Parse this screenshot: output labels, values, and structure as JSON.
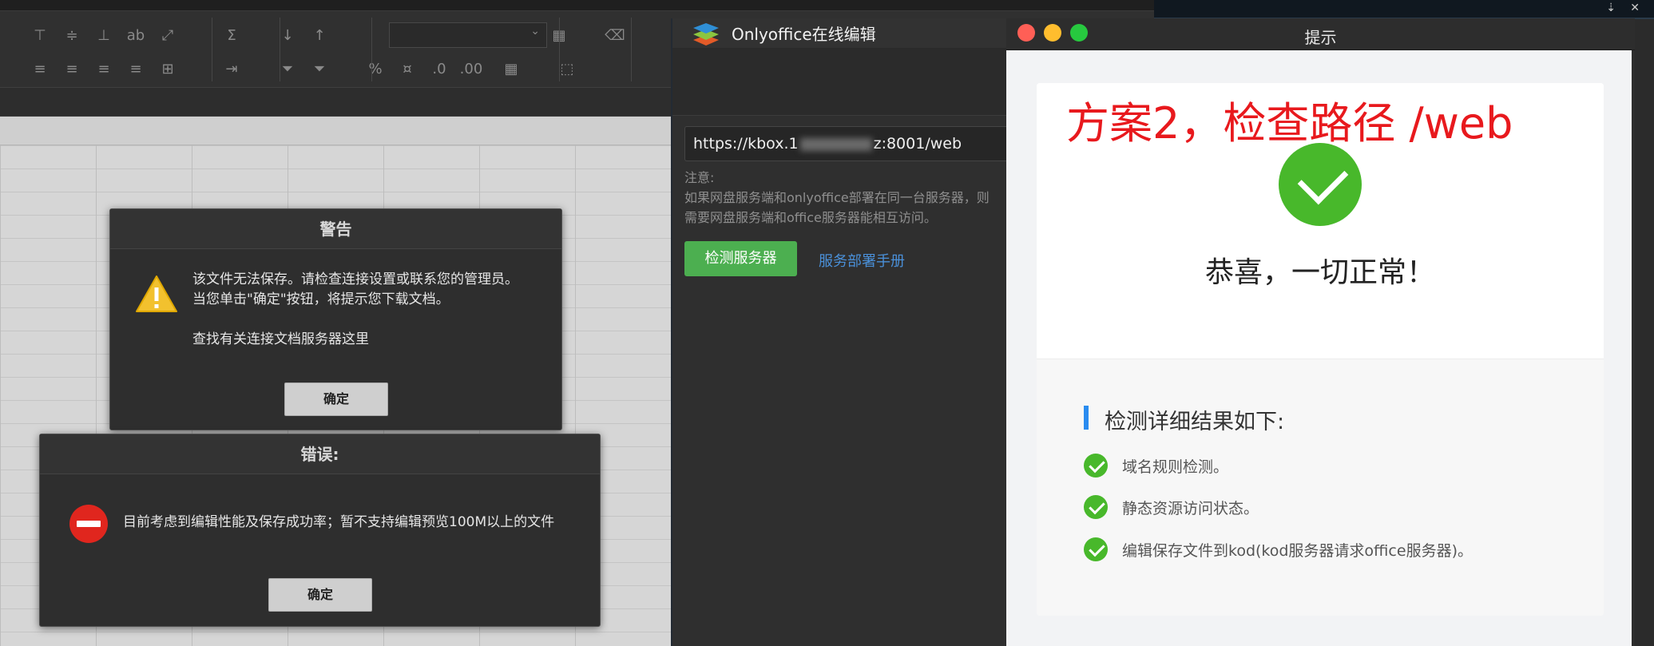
{
  "warning_dialog": {
    "title": "警告",
    "line1": "该文件无法保存。请检查连接设置或联系您的管理员。",
    "line2": "当您单击\"确定\"按钮，将提示您下载文档。",
    "line3": "查找有关连接文档服务器这里",
    "ok_label": "确定"
  },
  "error_dialog": {
    "title": "错误:",
    "message": "目前考虑到编辑性能及保存成功率；暂不支持编辑预览100M以上的文件",
    "ok_label": "确定"
  },
  "onlyoffice_window": {
    "title": "Onlyoffice在线编辑",
    "url_prefix": "https://kbox.1",
    "url_suffix": "z:8001/web",
    "note_label": "注意:",
    "note_line1": "如果网盘服务端和onlyoffice部署在同一台服务器，则",
    "note_line2": "需要网盘服务端和office服务器能相互访问。",
    "check_button": "检测服务器",
    "manual_link": "服务部署手册",
    "check_button_color": "#4caf50",
    "link_color": "#4a90d9"
  },
  "result_window": {
    "title": "提示",
    "annotation": "方案2，检查路径 /web",
    "success_message": "恭喜，一切正常！",
    "section_header": "检测详细结果如下:",
    "items": [
      {
        "label": "域名规则检测。"
      },
      {
        "label": "静态资源访问状态。"
      },
      {
        "label": "编辑保存文件到kod(kod服务器请求office服务器)。"
      }
    ],
    "annotation_color": "#e8191d",
    "success_color": "#48b82b",
    "section_accent": "#2a8cf0"
  },
  "icons": {
    "warning": "warning-triangle-icon",
    "error": "error-stop-icon",
    "success": "check-circle-icon",
    "logo": "onlyoffice-logo"
  }
}
